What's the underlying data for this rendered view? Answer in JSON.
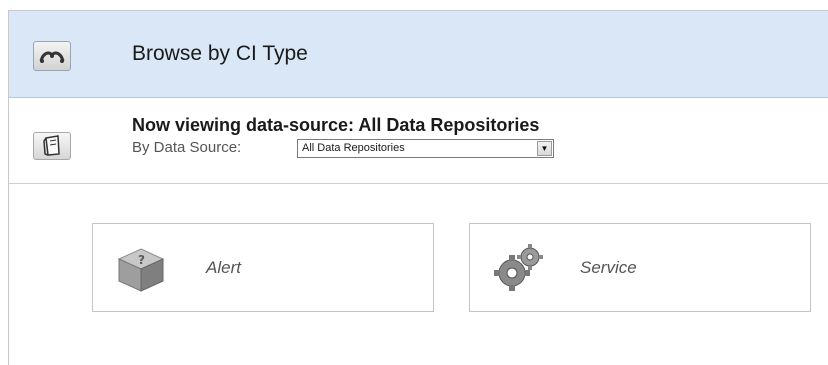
{
  "header": {
    "title": "Browse by CI Type",
    "icon": "ci-type-icon"
  },
  "data_source": {
    "title": "Now viewing data-source: All Data Repositories",
    "label": "By Data Source:",
    "selected": "All Data Repositories",
    "icon": "data-source-icon"
  },
  "ci_types": [
    {
      "label": "Alert",
      "icon": "alert-cube-icon"
    },
    {
      "label": "Service",
      "icon": "service-gears-icon"
    }
  ],
  "colors": {
    "header_bg": "#d9e7f7",
    "tile_border": "#c4c4c4",
    "label_text": "#555555"
  }
}
